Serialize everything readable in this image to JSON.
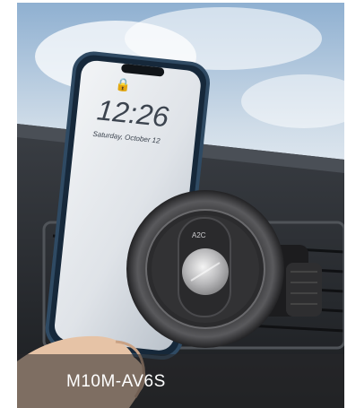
{
  "photo": {
    "lock_time": "12:26",
    "lock_date": "Saturday, October 12",
    "brand_mark": "A2C",
    "caption": "M10M-AV6S",
    "colors": {
      "sky_top": "#9fbad6",
      "sky_bottom": "#e8eef4",
      "dashboard": "#2c2f33",
      "phone_frame": "#1f3244",
      "mount_ring": "#2a2a2c",
      "caption_bar": "rgba(40,40,42,0.55)"
    }
  }
}
